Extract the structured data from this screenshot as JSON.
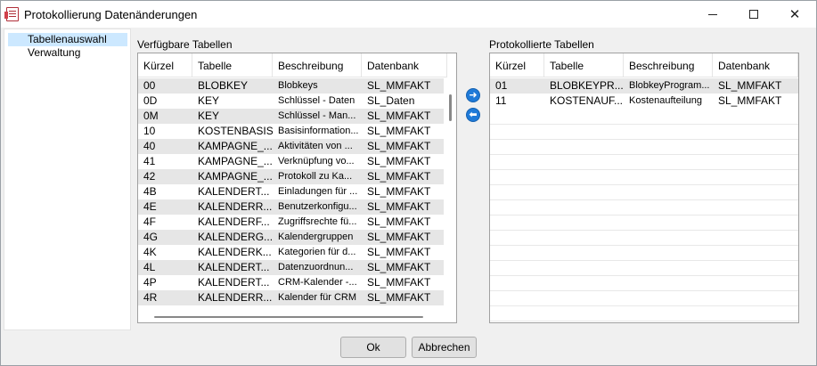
{
  "window": {
    "title": "Protokollierung Datenänderungen",
    "minimize": "–",
    "maximize": "□",
    "close": "✕"
  },
  "nav": {
    "items": [
      "Tabellenauswahl",
      "Verwaltung"
    ],
    "selected": "Tabellenauswahl"
  },
  "available": {
    "label": "Verfügbare Tabellen",
    "columns": [
      "Kürzel",
      "Tabelle",
      "Beschreibung",
      "Datenbank"
    ],
    "rows": [
      [
        "00",
        "BLOBKEY",
        "Blobkeys",
        "SL_MMFAKT"
      ],
      [
        "0D",
        "KEY",
        "Schlüssel - Daten",
        "SL_Daten"
      ],
      [
        "0M",
        "KEY",
        "Schlüssel - Man...",
        "SL_MMFAKT"
      ],
      [
        "10",
        "KOSTENBASIS",
        "Basisinformation...",
        "SL_MMFAKT"
      ],
      [
        "40",
        "KAMPAGNE_...",
        "Aktivitäten von ...",
        "SL_MMFAKT"
      ],
      [
        "41",
        "KAMPAGNE_...",
        "Verknüpfung vo...",
        "SL_MMFAKT"
      ],
      [
        "42",
        "KAMPAGNE_...",
        "Protokoll zu Ka...",
        "SL_MMFAKT"
      ],
      [
        "4B",
        "KALENDERT...",
        "Einladungen für ...",
        "SL_MMFAKT"
      ],
      [
        "4E",
        "KALENDERR...",
        "Benutzerkonfigu...",
        "SL_MMFAKT"
      ],
      [
        "4F",
        "KALENDERF...",
        "Zugriffsrechte fü...",
        "SL_MMFAKT"
      ],
      [
        "4G",
        "KALENDERG...",
        "Kalendergruppen",
        "SL_MMFAKT"
      ],
      [
        "4K",
        "KALENDERK...",
        "Kategorien für d...",
        "SL_MMFAKT"
      ],
      [
        "4L",
        "KALENDERT...",
        "Datenzuordnun...",
        "SL_MMFAKT"
      ],
      [
        "4P",
        "KALENDERT...",
        "CRM-Kalender -...",
        "SL_MMFAKT"
      ],
      [
        "4R",
        "KALENDERR...",
        "Kalender für CRM",
        "SL_MMFAKT"
      ]
    ]
  },
  "protocolled": {
    "label": "Protokollierte Tabellen",
    "columns": [
      "Kürzel",
      "Tabelle",
      "Beschreibung",
      "Datenbank"
    ],
    "rows": [
      [
        "01",
        "BLOBKEYPR...",
        "BlobkeyProgram...",
        "SL_MMFAKT"
      ],
      [
        "11",
        "KOSTENAUF...",
        "Kostenaufteilung",
        "SL_MMFAKT"
      ]
    ]
  },
  "transfer": {
    "add_glyph": "➜",
    "remove_glyph": "⬅"
  },
  "buttons": {
    "ok": "Ok",
    "cancel": "Abbrechen"
  }
}
